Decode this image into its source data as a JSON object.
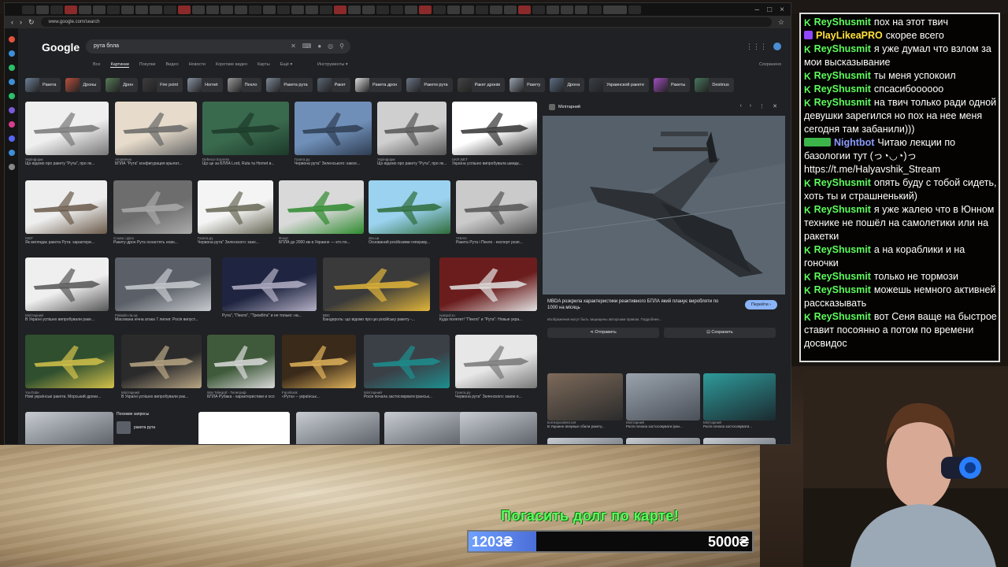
{
  "browser": {
    "url": "www.google.com/search",
    "tab_hd_label": "HD"
  },
  "google": {
    "logo": "Google",
    "query": "рута бпла",
    "nav": [
      "Все",
      "Картинки",
      "Покупки",
      "Видео",
      "Новости",
      "Короткие видео",
      "Карты",
      "Ещё ▾"
    ],
    "nav_active_index": 1,
    "tools": "Инструменты ▾",
    "saved": "Сохранено",
    "chips": [
      "Ракета",
      "Дроны",
      "Дрон",
      "Fire point",
      "Hornet",
      "Пекло",
      "Ракета рута",
      "Ракет",
      "Ракета дрон",
      "Ракети рута",
      "Ракет дронів",
      "Ракету",
      "Дрона",
      "Украинской ракете",
      "Ракеты",
      "Destinus"
    ],
    "results": [
      {
        "src": "Укрінформ",
        "title": "Що відомо про ракету \"Рута\", про як..."
      },
      {
        "src": "AmaMews",
        "title": "БПЛА \"Рута\" конфигурация крылат..."
      },
      {
        "src": "Defence Express",
        "title": "Що це за БПЛА Lord, Ruta та Hornet в..."
      },
      {
        "src": "Газета.ру",
        "title": "Червона рута\" Зеленського: какое..."
      },
      {
        "src": "Укрінформ",
        "title": "Що відомо про ракету \"Рута\", про як..."
      },
      {
        "src": "UKR.NET",
        "title": "Україна успішно випробувала швидк..."
      },
      {
        "src": "ISEF",
        "title": "Як виглядає ракета Рута: характери..."
      },
      {
        "src": "Слово і Діло",
        "title": "Ракету-дрон Рута оснастять ново..."
      },
      {
        "src": "Газета.ру",
        "title": "Червона рута\" Зеленского: како..."
      },
      {
        "src": "Фокус",
        "title": "БПЛА до 2000 км в Украине — кто по..."
      },
      {
        "src": "dev.ua",
        "title": "Оснований російскими гиперзву..."
      },
      {
        "src": "УНІАН",
        "title": "Ракета Рута і Пекло - експерт розп..."
      },
      {
        "src": "Мілітарний",
        "title": "В Україні успішно випробували раке..."
      },
      {
        "src": "Paliadin.ria.ua",
        "title": "Масована нічна атака 7 липня: Росія випуст..."
      },
      {
        "src": "",
        "title": "Рута\", \"Пекло\", \"Трембіта\" и не только: на..."
      },
      {
        "src": "BBC",
        "title": "Бандероль: що відомо про цю російську ракету -..."
      },
      {
        "src": "Ivanpol.ru",
        "title": "Куда полетит! \"Пекло\" и \"Рута\": Новые укра..."
      },
      {
        "src": "YouTube",
        "title": "Нові українські ракети, Морський дрони..."
      },
      {
        "src": "Мілітарний",
        "title": "В Україні успішно випробували рак..."
      },
      {
        "src": "War Telegraf - Телеграф",
        "title": "БПЛА Рубака - характеристики и особе..."
      },
      {
        "src": "Facebook",
        "title": "«Рута» – українськ..."
      },
      {
        "src": "Мілітарний",
        "title": "Росія почала застосовувати іранськ..."
      },
      {
        "src": "Газета.ру",
        "title": "Червона рута\" Зеленского: какое о..."
      }
    ],
    "similar_title": "Похожие запросы",
    "similar_item": "ракета рута"
  },
  "preview": {
    "source": "Мілітарний",
    "title": "MBDA розкрила характеристики реактивного БПЛА який планує виробляти по 1000 на місяць",
    "note": "Изображения могут быть защищены авторским правом. Подробнее...",
    "go_label": "Перейти ›",
    "share_label": "⋖ Отправить",
    "save_label": "⊡ Сохранить",
    "related": [
      {
        "src": "korrespondent.net",
        "title": "В Украине впервые сбили ракету..."
      },
      {
        "src": "Мілітарний",
        "title": "Росія почала застосовувати іран..."
      },
      {
        "src": "Мілітарний",
        "title": "Росія почала застосовувати..."
      }
    ]
  },
  "chat": [
    {
      "user": "ReyShusmit",
      "color": "#5dfc5d",
      "badge": "k",
      "text": "пох на этот твич"
    },
    {
      "user": "PlayLikeaPRO",
      "color": "#ffe23c",
      "badge": "tw",
      "text": "скорее всего"
    },
    {
      "user": "ReyShusmit",
      "color": "#5dfc5d",
      "badge": "k",
      "text": "я уже думал что взлом за мои высказывание"
    },
    {
      "user": "ReyShusmit",
      "color": "#5dfc5d",
      "badge": "k",
      "text": "ты меня успокоил"
    },
    {
      "user": "ReyShusmit",
      "color": "#5dfc5d",
      "badge": "k",
      "text": "спсасибоооооо"
    },
    {
      "user": "ReyShusmit",
      "color": "#5dfc5d",
      "badge": "k",
      "text": "на твич только ради одной девушки зарегился но пох на нее меня сегодня там забанили)))"
    },
    {
      "user": "Nightbot",
      "color": "#8a9bff",
      "badge": "bot",
      "text": "Читаю лекции по базологии тут (っ◔◡◔)っ https://t.me/Halyavshik_Stream"
    },
    {
      "user": "ReyShusmit",
      "color": "#5dfc5d",
      "badge": "k",
      "text": "опять буду с тобой сидеть, хоть ты и страшненький)"
    },
    {
      "user": "ReyShusmit",
      "color": "#5dfc5d",
      "badge": "k",
      "text": "я уже жалею что в Юнном технике не пошёл на самолетики или на ракетки"
    },
    {
      "user": "ReyShusmit",
      "color": "#5dfc5d",
      "badge": "k",
      "text": "а на кораблики и на гоночки"
    },
    {
      "user": "ReyShusmit",
      "color": "#5dfc5d",
      "badge": "k",
      "text": "только не тормози"
    },
    {
      "user": "ReyShusmit",
      "color": "#5dfc5d",
      "badge": "k",
      "text": "можешь немного активней рассказывать"
    },
    {
      "user": "ReyShusmit",
      "color": "#5dfc5d",
      "badge": "k",
      "text": "вот Сеня ваще на быстрое ставит посоянно а потом по времени досвидос"
    }
  ],
  "donation": {
    "label": "Погасить долг по карте!",
    "current": "1203₴",
    "goal": "5000₴",
    "progress": 0.24,
    "accent": "#5dfc5d"
  }
}
